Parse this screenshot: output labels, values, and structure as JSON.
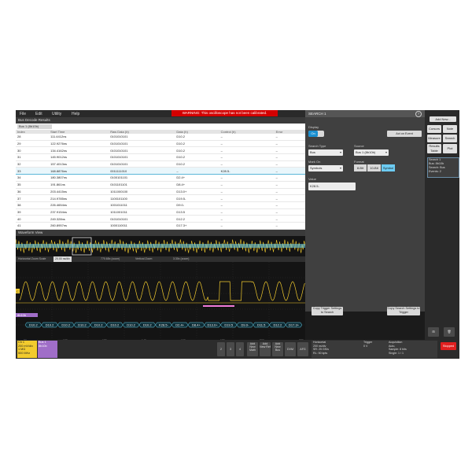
{
  "menu": [
    "File",
    "Edit",
    "Utility",
    "Help"
  ],
  "warning": "WARNING: This oscilloscope has not been calibrated.",
  "decode": {
    "title": "Bus Decode Results",
    "tab": "Bus 1 (8b10b)",
    "columns": [
      "Index",
      "Start Time",
      "Raw Data (b)",
      "Data (h)",
      "Control (h)",
      "Error"
    ],
    "rows": [
      [
        "28",
        "111.4412ns",
        "0101010101",
        "D10.2",
        "–",
        "–"
      ],
      [
        "29",
        "122.9276ns",
        "0101010101",
        "D10.2",
        "–",
        "–"
      ],
      [
        "30",
        "134.4162ns",
        "0101010101",
        "D10.2",
        "–",
        "–"
      ],
      [
        "31",
        "145.9012ns",
        "0101010101",
        "D10.2",
        "–",
        "–"
      ],
      [
        "32",
        "157.4013ns",
        "0101010101",
        "D10.2",
        "–",
        "–"
      ],
      [
        "33",
        "168.8876ns",
        "0011111010",
        "–",
        "K28.5-",
        "–"
      ],
      [
        "34",
        "180.3807ns",
        "0100101101",
        "D2.4+",
        "–",
        "–"
      ],
      [
        "35",
        "191.861ns",
        "0101101101",
        "D8.4+",
        "–",
        "–"
      ],
      [
        "36",
        "203.4415ns",
        "1011000100",
        "D13.0+",
        "–",
        "–"
      ],
      [
        "37",
        "214.9785ns",
        "1100101100",
        "D19.5-",
        "–",
        "–"
      ],
      [
        "38",
        "226.4654ns",
        "1001011011",
        "D9.0-",
        "–",
        "–"
      ],
      [
        "39",
        "237.9154ns",
        "1011001011",
        "D13.5",
        "–",
        "–"
      ],
      [
        "40",
        "249.328ns",
        "0101010101",
        "D12.2",
        "–",
        "–"
      ],
      [
        "41",
        "260.8957ns",
        "1000110011",
        "D17.3+",
        "–",
        "–"
      ]
    ]
  },
  "search": {
    "title": "SEARCH 1",
    "help": "?",
    "display_label": "Display",
    "display_value": "On",
    "act_on_event": "Act on Event",
    "search_type_label": "Search Type",
    "search_type": "Bus",
    "source_label": "Source",
    "source": "Bus 1 (8b10b)",
    "mark_on_label": "Mark On",
    "mark_on": "Symbols",
    "format_label": "Format",
    "formats": [
      "8-Bit",
      "10-Bit",
      "Symbol"
    ],
    "value_label": "Value",
    "value": "K28.5-",
    "copy_trigger": "Copy Trigger Settings to Search",
    "copy_search": "Copy Search Settings to Trigger"
  },
  "side": {
    "add_new": "Add New...",
    "cursors": "Cursors",
    "note": "Note",
    "measure": "Measure",
    "search": "Search",
    "results_table": "Results Table",
    "plot": "Plot",
    "badge_title": "Search 1",
    "badge_lines": [
      "Bus: 8b10b",
      "Search: Bus",
      "Events: 2"
    ]
  },
  "waveform": {
    "title": "Waveform View",
    "zoom_labels": [
      "Horizontal Zoom Scale",
      "20.00 ns/div",
      "770.68x (zoom)",
      "Vertical Zoom",
      "3.30x (zoom)"
    ],
    "bus_label": "8b10b",
    "symbols": [
      "D10.2",
      "D10.2",
      "D10.2",
      "D10.2",
      "D10.2",
      "D10.2",
      "D10.2",
      "D10.2",
      "K28.5-",
      "D2.4+",
      "D8.4+",
      "D13.0+",
      "D19.5",
      "D9.0-",
      "D11.5",
      "D12.2",
      "D17.3+"
    ],
    "time_ticks": [
      "80 ns",
      "100 ns",
      "120 ns",
      "140 ns",
      "160 ns",
      "180 ns",
      "200 ns",
      "220 ns"
    ],
    "colors": {
      "ch1": "#f2cb2e",
      "bus": "#a06ec8",
      "highlight": "#6cd6f0",
      "mark": "#f07ad8"
    }
  },
  "bottom": {
    "ch1": [
      "Ch 1",
      "200 mV/div",
      "1 MΩ",
      "500 MHz"
    ],
    "bus1": [
      "Bus 1",
      "8b10b"
    ],
    "channels": [
      "2",
      "3",
      "4"
    ],
    "add_buttons": [
      "Add New Math",
      "Add New Ref",
      "Add New Bus",
      "DVM",
      "AFG"
    ],
    "horizontal": [
      "Horizontal",
      "200 ns/div",
      "SR: 25 GS/s",
      "RL: 50 kpts"
    ],
    "horizontal_right": [
      "2 µs",
      "40 ps/pt",
      "10%"
    ],
    "trigger": [
      "Trigger",
      "0 V"
    ],
    "acquisition": [
      "Acquisition",
      "Auto,",
      "Analyze",
      "Sample: 8 bits",
      "Single: 1 / 1"
    ],
    "stopped": "Stopped"
  }
}
